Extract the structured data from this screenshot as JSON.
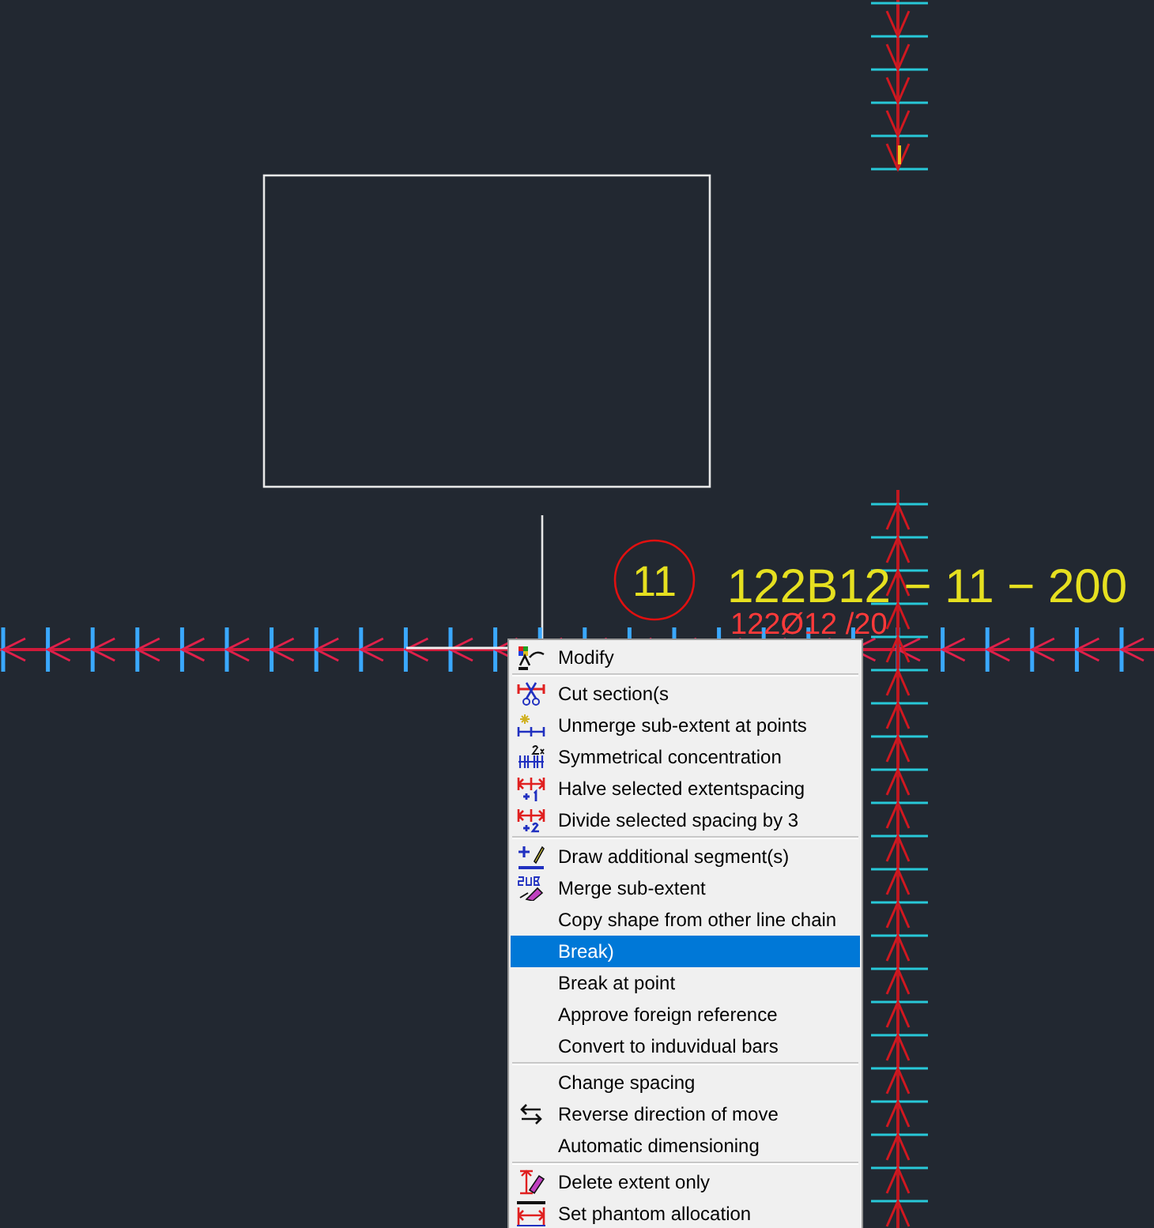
{
  "canvas": {
    "marker": "11",
    "label": "122B12 − 11 − 200",
    "sublabel": "122Ø12 /20"
  },
  "context_menu": {
    "groups": [
      [
        {
          "label": "Modify",
          "kind": "modify",
          "selected": false
        }
      ],
      [
        {
          "label": "Cut section(s",
          "kind": "cut",
          "selected": false
        },
        {
          "label": "Unmerge sub-extent at points",
          "kind": "unmerge",
          "selected": false
        },
        {
          "label": "Symmetrical concentration",
          "kind": "symmetric",
          "selected": false
        },
        {
          "label": "Halve selected extentspacing",
          "kind": "halve",
          "selected": false
        },
        {
          "label": "Divide selected spacing by 3",
          "kind": "divide",
          "selected": false
        }
      ],
      [
        {
          "label": "Draw additional segment(s)",
          "kind": "draw",
          "selected": false
        },
        {
          "label": "Merge sub-extent",
          "kind": "merge",
          "selected": false
        },
        {
          "label": "Copy shape from other line chain",
          "kind": "plain",
          "selected": false
        },
        {
          "label": "Break)",
          "kind": "plain",
          "selected": true
        },
        {
          "label": "Break at point",
          "kind": "plain",
          "selected": false
        },
        {
          "label": "Approve foreign reference",
          "kind": "plain",
          "selected": false
        },
        {
          "label": "Convert to induvidual bars",
          "kind": "plain",
          "selected": false
        }
      ],
      [
        {
          "label": "Change spacing",
          "kind": "plain",
          "selected": false
        },
        {
          "label": "Reverse direction of move",
          "kind": "reverse",
          "selected": false
        },
        {
          "label": "Automatic dimensioning",
          "kind": "plain",
          "selected": false
        }
      ],
      [
        {
          "label": "Delete extent only",
          "kind": "delete",
          "selected": false
        },
        {
          "label": "Set phantom allocation",
          "kind": "phantom",
          "selected": false
        }
      ]
    ]
  }
}
